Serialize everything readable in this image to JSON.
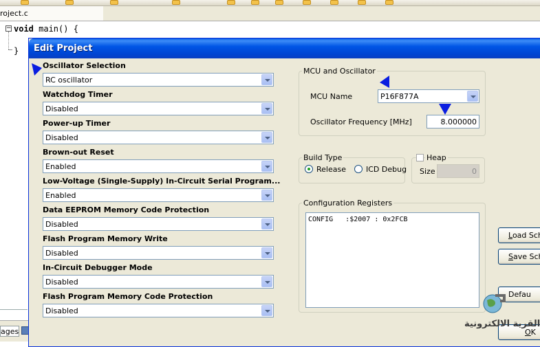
{
  "ide": {
    "file_tab": "roject.c",
    "code_lines": [
      "void main() {",
      "}"
    ],
    "code_keyword": "void",
    "code_rest": " main() {",
    "fold_symbol": "−",
    "bottom_tab": "ages"
  },
  "dialog": {
    "title": "Edit Project",
    "settings": [
      {
        "label": "Oscillator Selection",
        "value": "RC oscillator"
      },
      {
        "label": "Watchdog Timer",
        "value": "Disabled"
      },
      {
        "label": "Power-up Timer",
        "value": "Disabled"
      },
      {
        "label": "Brown-out Reset",
        "value": "Enabled"
      },
      {
        "label": "Low-Voltage (Single-Supply) In-Circuit Serial Program...",
        "value": "Enabled"
      },
      {
        "label": "Data EEPROM Memory Code Protection",
        "value": "Disabled"
      },
      {
        "label": "Flash Program Memory Write",
        "value": "Disabled"
      },
      {
        "label": "In-Circuit Debugger Mode",
        "value": "Disabled"
      },
      {
        "label": "Flash Program Memory Code Protection",
        "value": "Disabled"
      }
    ],
    "mcu_group": {
      "title": "MCU and Oscillator",
      "mcu_name_label": "MCU Name",
      "mcu_name_value": "P16F877A",
      "freq_label": "Oscillator Frequency [MHz]",
      "freq_value": "8.000000"
    },
    "build_type": {
      "title": "Build Type",
      "release_label": "Release",
      "icd_label": "ICD Debug",
      "selected": "Release"
    },
    "heap": {
      "label": "Heap",
      "checked": false,
      "size_label": "Size",
      "size_value": "0"
    },
    "config": {
      "title": "Configuration Registers",
      "text": "CONFIG   :$2007 : 0x2FCB"
    },
    "buttons": {
      "load_prefix": "L",
      "load_rest": "oad Sch",
      "save_prefix": "S",
      "save_rest": "ave Sch",
      "default_label": "Defau",
      "ok_prefix": "O",
      "ok_rest": "K"
    }
  },
  "watermark": {
    "text": "القرية الالكترونية"
  },
  "colors": {
    "titlebar": "#0055e5",
    "dialog_bg": "#ece9d8",
    "pointer": "#0a1ee0"
  }
}
